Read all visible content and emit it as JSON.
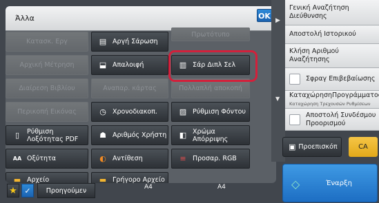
{
  "panel": {
    "title": "Άλλα",
    "ok_label": "OK"
  },
  "grid": {
    "row1": [
      "Κατασκ. Εργ",
      "Αργή Σάρωση",
      "Πρωτότυπο"
    ],
    "row2": [
      "Αρχική Μέτρηση",
      "Απαλοιφή",
      "Σάρ Διπλ Σελ"
    ],
    "row3": [
      "Διαίρεση Βιβλίου",
      "Αναπαρ. κάρτας",
      "Πολλαπλή αποκοπή"
    ],
    "row4": [
      "Περικοπή Εικόνας",
      "Χρονοδιακοπ.",
      "Ρύθμιση Φόντου"
    ],
    "row5": [
      "Ρύθμιση Λοξότητας PDF",
      "Αριθμός Χρήστη",
      "Χρώμα Απόρριψης"
    ],
    "row6": [
      "Οξύτητα",
      "Αντίθεση",
      "Προσαρ. RGB"
    ],
    "row7": [
      "Αρχείο",
      "Γρήγορο Αρχείο"
    ]
  },
  "bottom": {
    "prev_label": "Προηγούμεν",
    "paper1": "A4",
    "paper2": "A4"
  },
  "right": {
    "item1": "Γενική Αναζήτηση Διεύθυνσης",
    "item2": "Αποστολή Ιστορικού",
    "item3": "Κλήση Αριθμού Αναζήτησης",
    "item4": "Σφραγ Επιβεβαίωσης",
    "item5_main": "ΚαταχώρησηΠρογράμματος",
    "item5_sub": "Καταχώρηση Τρεχουσών Ρυθμίσεων",
    "item6": "Αποστολή Συνδέσμου Προορισμού",
    "preview_label": "Προεπισκόπ",
    "ca_label": "CA",
    "start_label": "Έναρξη"
  },
  "colors": {
    "highlight": "#d3203b",
    "ok": "#1b62b0",
    "ca": "#e2a91a",
    "start": "#1d6ec3"
  }
}
